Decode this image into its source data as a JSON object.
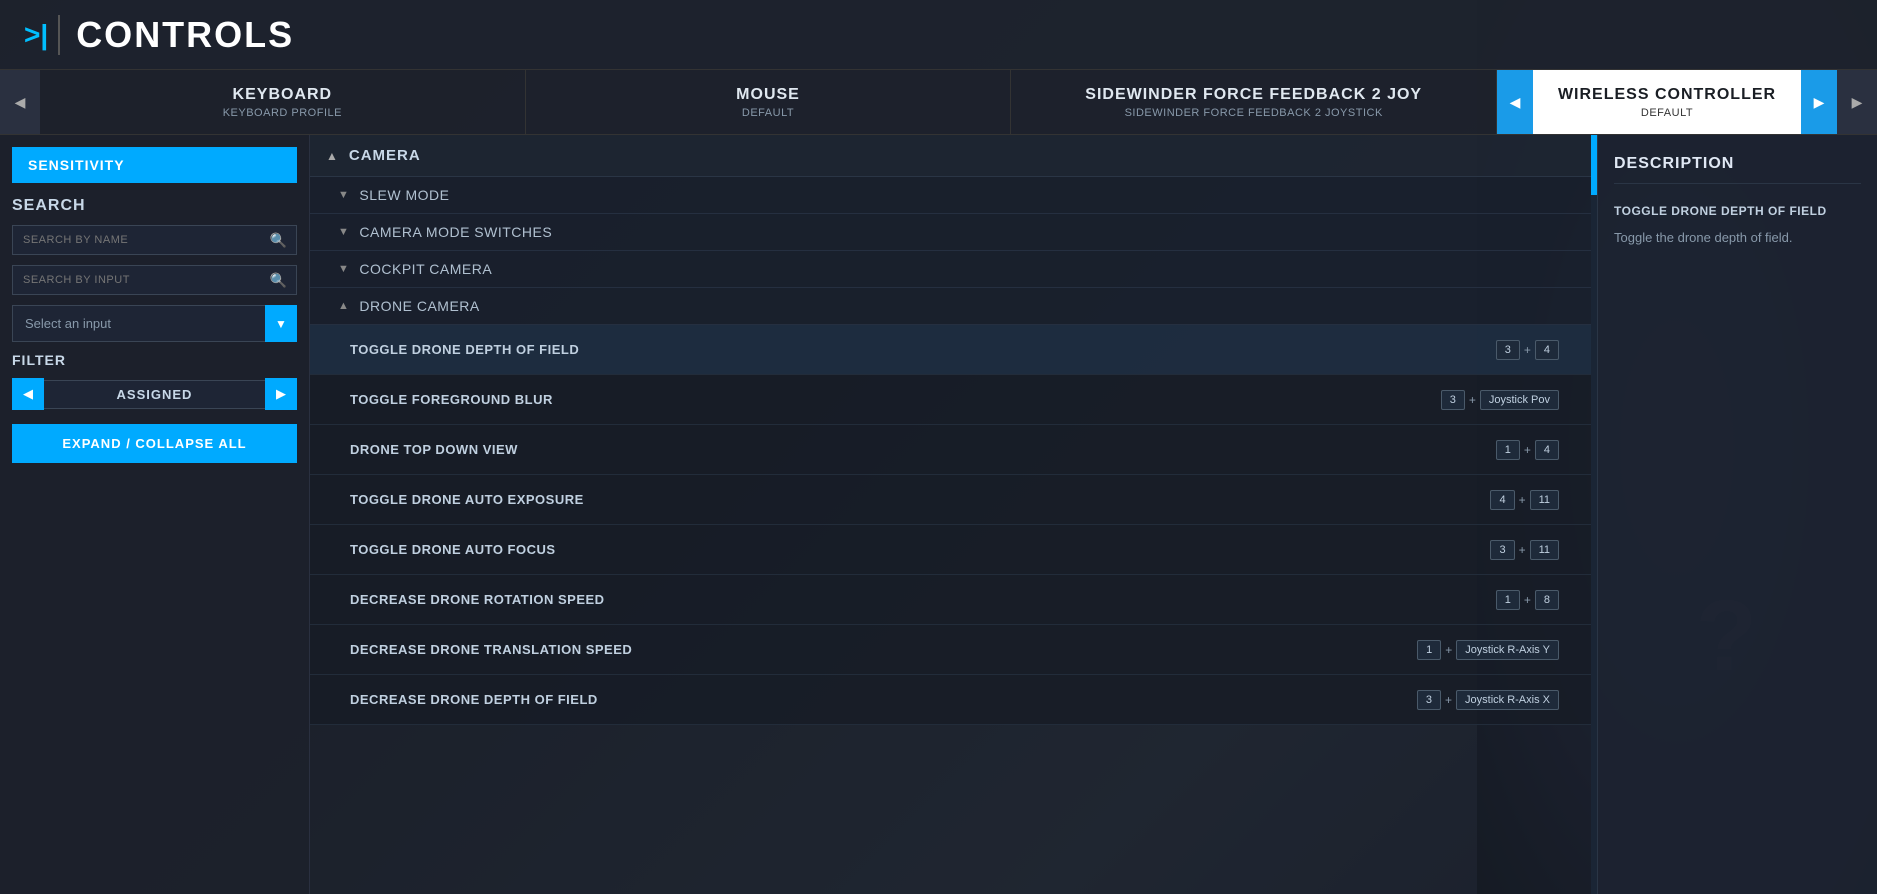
{
  "header": {
    "icon": ">|",
    "title": "CONTROLS"
  },
  "tabs": [
    {
      "id": "keyboard",
      "name": "KEYBOARD",
      "profile": "KEYBOARD PROFILE",
      "active": false
    },
    {
      "id": "mouse",
      "name": "MOUSE",
      "profile": "DEFAULT",
      "active": false
    },
    {
      "id": "sidewinder",
      "name": "SIDEWINDER FORCE FEEDBACK 2 JOY",
      "profile": "SIDEWINDER FORCE FEEDBACK 2 JOYSTICK",
      "active": false
    },
    {
      "id": "wireless",
      "name": "WIRELESS CONTROLLER",
      "profile": "DEFAULT",
      "active": true
    }
  ],
  "nav_prev_label": "◀",
  "nav_next_label": "▶",
  "sidebar": {
    "sensitivity_label": "SENSITIVITY",
    "search_section": "SEARCH",
    "search_by_name_placeholder": "SEARCH BY NAME",
    "search_by_input_placeholder": "SEARCH BY INPUT",
    "select_input_label": "Select an input",
    "filter_section": "FILTER",
    "filter_prev": "◀",
    "filter_next": "▶",
    "filter_value": "ASSIGNED",
    "expand_collapse_label": "EXPAND / COLLAPSE ALL"
  },
  "categories": [
    {
      "id": "camera",
      "name": "CAMERA",
      "expanded": true,
      "arrow": "▲",
      "subcategories": [
        {
          "id": "slew_mode",
          "name": "SLEW MODE",
          "expanded": false,
          "arrow": "▼",
          "bindings": []
        },
        {
          "id": "camera_mode",
          "name": "CAMERA MODE SWITCHES",
          "expanded": false,
          "arrow": "▼",
          "bindings": []
        },
        {
          "id": "cockpit",
          "name": "COCKPIT CAMERA",
          "expanded": false,
          "arrow": "▼",
          "bindings": []
        },
        {
          "id": "drone_camera",
          "name": "DRONE CAMERA",
          "expanded": true,
          "arrow": "▲",
          "bindings": [
            {
              "id": "toggle_drone_dof",
              "name": "TOGGLE DRONE DEPTH OF FIELD",
              "keys": [
                {
                  "label": "3"
                },
                {
                  "sep": "+"
                },
                {
                  "label": "4"
                }
              ],
              "active": true
            },
            {
              "id": "toggle_foreground_blur",
              "name": "TOGGLE FOREGROUND BLUR",
              "keys": [
                {
                  "label": "3"
                },
                {
                  "sep": "+"
                },
                {
                  "label": "Joystick Pov"
                }
              ]
            },
            {
              "id": "drone_top_down",
              "name": "DRONE TOP DOWN VIEW",
              "keys": [
                {
                  "label": "1"
                },
                {
                  "sep": "+"
                },
                {
                  "label": "4"
                }
              ]
            },
            {
              "id": "toggle_drone_auto_exposure",
              "name": "TOGGLE DRONE AUTO EXPOSURE",
              "keys": [
                {
                  "label": "4"
                },
                {
                  "sep": "+"
                },
                {
                  "label": "11"
                }
              ]
            },
            {
              "id": "toggle_drone_auto_focus",
              "name": "TOGGLE DRONE AUTO FOCUS",
              "keys": [
                {
                  "label": "3"
                },
                {
                  "sep": "+"
                },
                {
                  "label": "11"
                }
              ]
            },
            {
              "id": "decrease_drone_rotation",
              "name": "DECREASE DRONE ROTATION SPEED",
              "keys": [
                {
                  "label": "1"
                },
                {
                  "sep": "+"
                },
                {
                  "label": "8"
                }
              ]
            },
            {
              "id": "decrease_drone_translation",
              "name": "DECREASE DRONE TRANSLATION SPEED",
              "keys": [
                {
                  "label": "1"
                },
                {
                  "sep": "+"
                },
                {
                  "label": "Joystick R-Axis Y"
                }
              ]
            },
            {
              "id": "decrease_drone_depth",
              "name": "DECREASE DRONE DEPTH OF FIELD",
              "keys": [
                {
                  "label": "3"
                },
                {
                  "sep": "+"
                },
                {
                  "label": "Joystick R-Axis X"
                }
              ]
            }
          ]
        }
      ]
    }
  ],
  "description": {
    "title": "DESCRIPTION",
    "action_name": "TOGGLE DRONE DEPTH OF FIELD",
    "text": "Toggle the drone depth of field."
  },
  "question_mark": "?",
  "colors": {
    "accent": "#00aaff",
    "active_tab_bg": "#ffffff",
    "active_tab_text": "#1a1e24"
  }
}
